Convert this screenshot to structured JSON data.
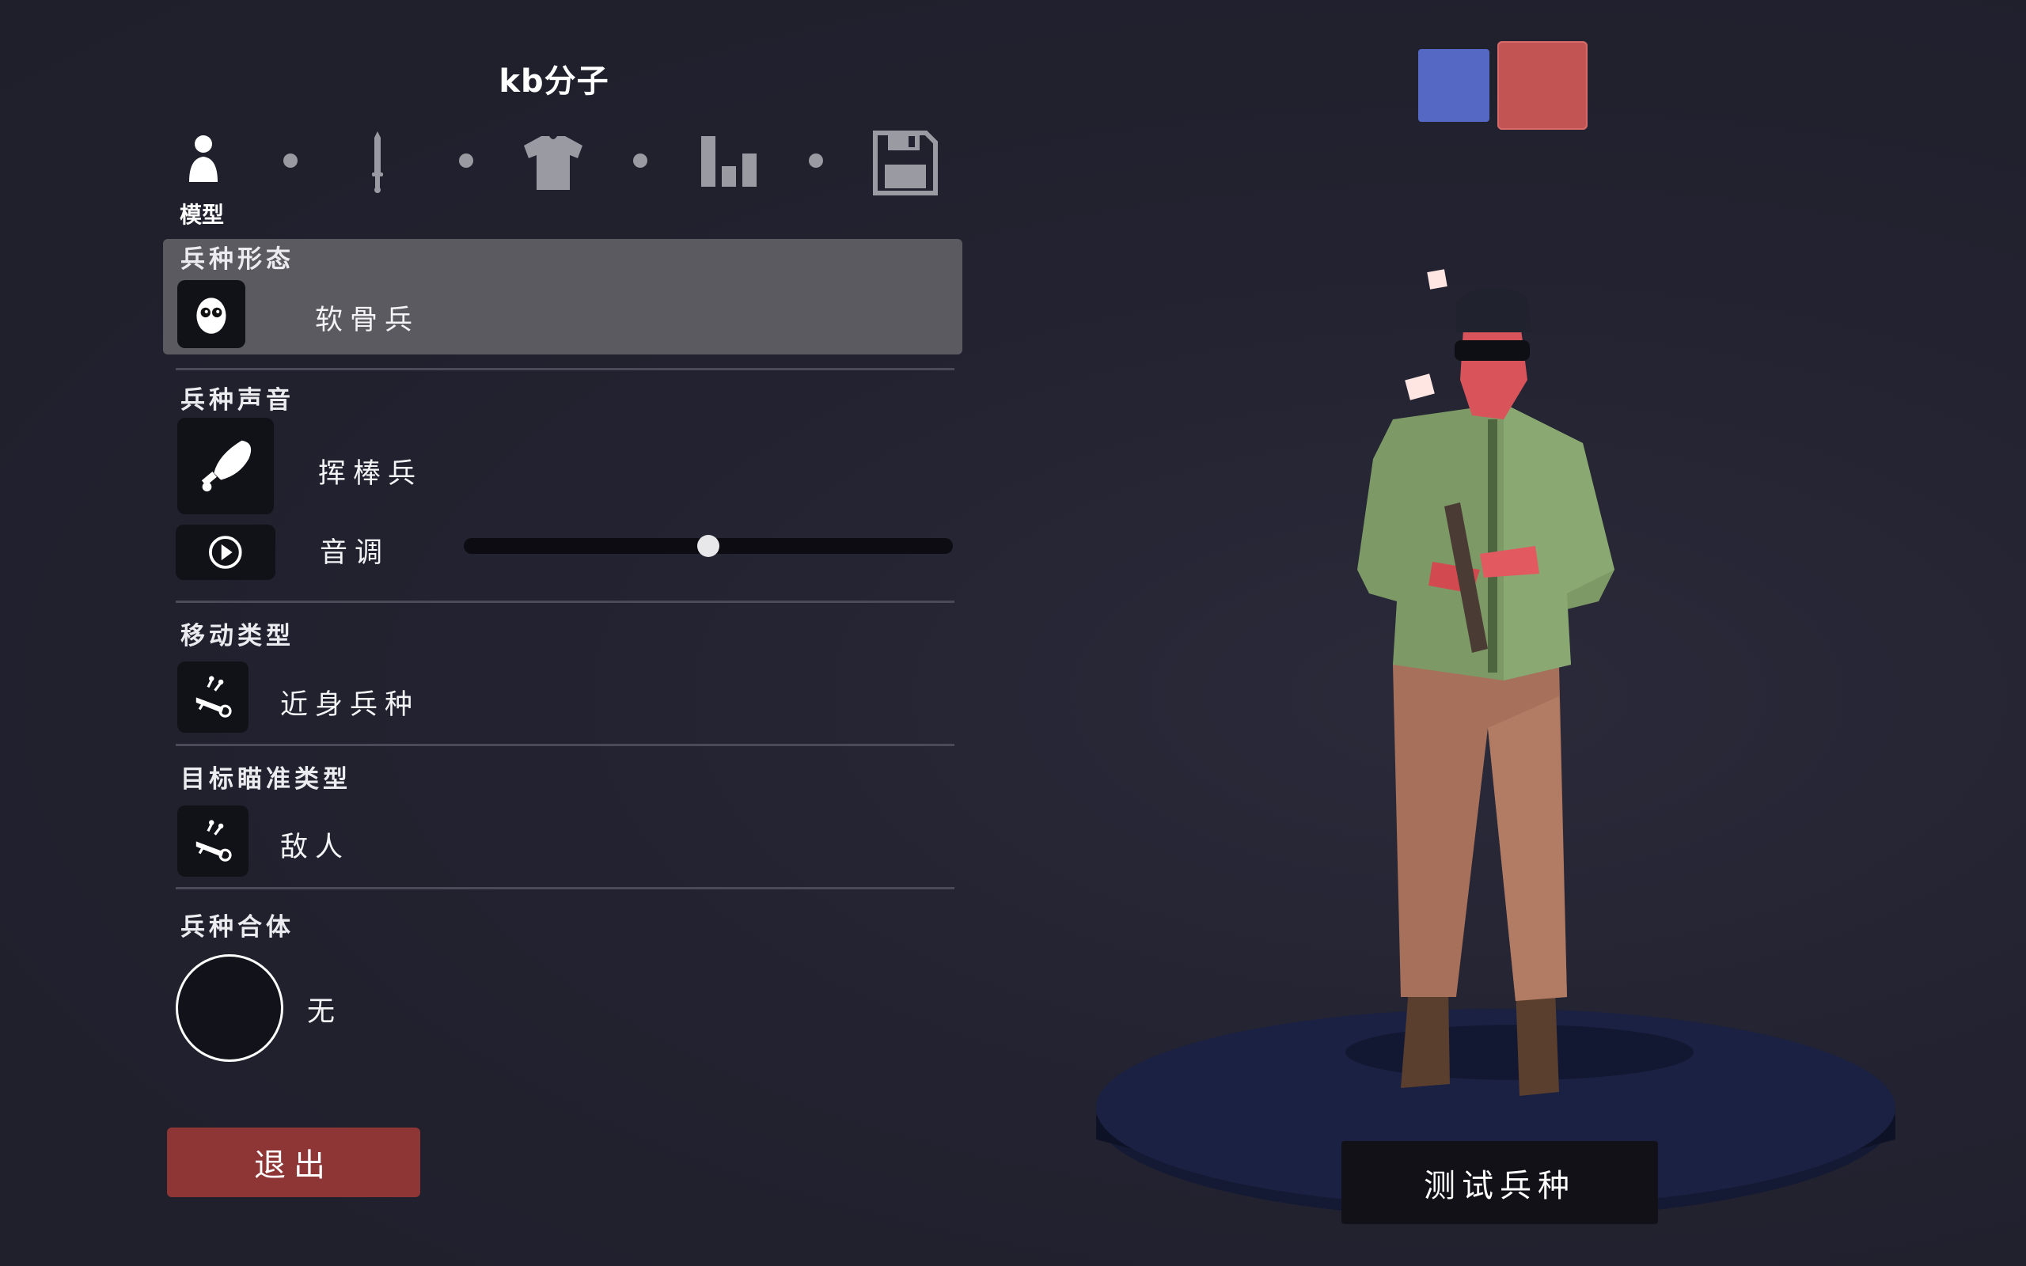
{
  "header": {
    "title": "kb分子"
  },
  "steps": {
    "active_label": "模型",
    "items": [
      {
        "icon": "person-icon",
        "active": true
      },
      {
        "icon": "sword-icon",
        "active": false
      },
      {
        "icon": "shirt-icon",
        "active": false
      },
      {
        "icon": "stats-icon",
        "active": false
      },
      {
        "icon": "save-icon",
        "active": false
      }
    ]
  },
  "sections": {
    "form": {
      "title": "兵种形态",
      "value": "软骨兵",
      "icon": "skull-mask-icon"
    },
    "voice": {
      "title": "兵种声音",
      "value": "挥棒兵",
      "icon": "club-icon",
      "pitch_label": "音调",
      "pitch_value": 0.5,
      "play_icon": "play-icon"
    },
    "movement": {
      "title": "移动类型",
      "value": "近身兵种",
      "icon": "wheelbarrow-icon"
    },
    "targeting": {
      "title": "目标瞄准类型",
      "value": "敌人",
      "icon": "wheelbarrow-icon"
    },
    "merge": {
      "title": "兵种合体",
      "value": "无"
    }
  },
  "buttons": {
    "exit": "退出",
    "test_unit": "测试兵种"
  },
  "teams": [
    {
      "name": "blue",
      "color": "#5468c4",
      "selected": false
    },
    {
      "name": "red",
      "color": "#c25454",
      "selected": true
    }
  ]
}
